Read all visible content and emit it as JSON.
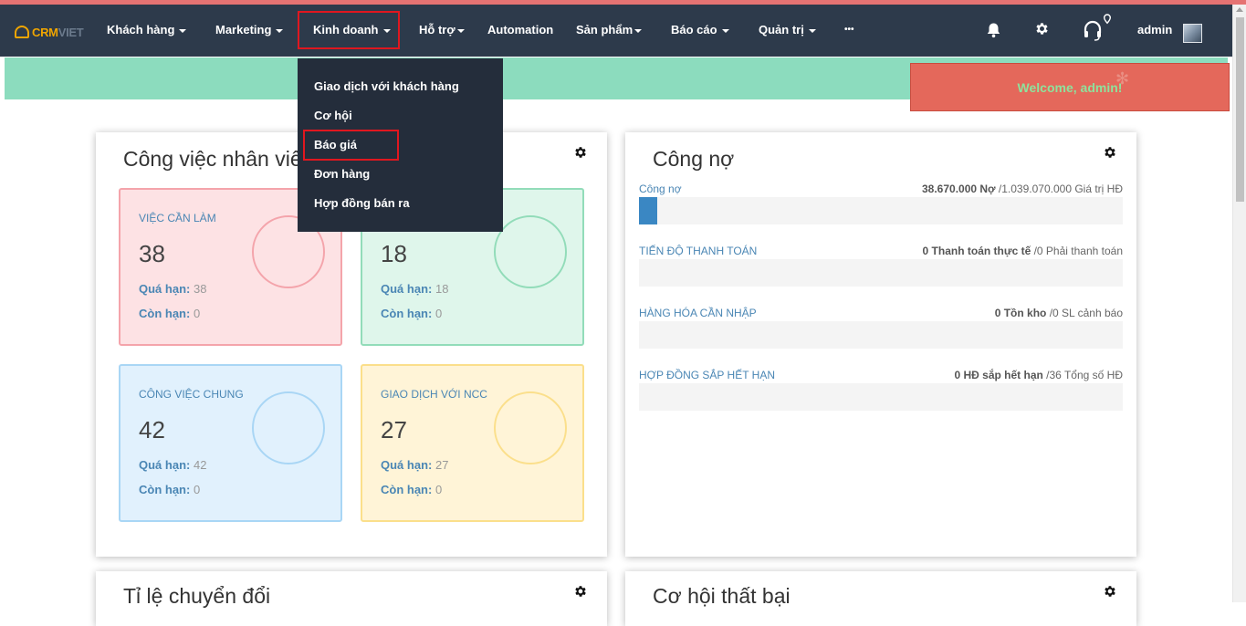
{
  "brand": {
    "part1": "CRM",
    "part2": "VIET"
  },
  "nav": {
    "items": [
      {
        "label": "Khách hàng"
      },
      {
        "label": "Marketing"
      },
      {
        "label": "Kinh doanh"
      },
      {
        "label": "Hỗ trợ"
      },
      {
        "label": "Automation"
      },
      {
        "label": "Sản phẩm"
      },
      {
        "label": "Báo cáo"
      },
      {
        "label": "Quản trị"
      },
      {
        "label": "•••"
      }
    ],
    "user": "admin"
  },
  "dropdown": {
    "items": [
      {
        "label": "Giao dịch với khách hàng"
      },
      {
        "label": "Cơ hội"
      },
      {
        "label": "Báo giá"
      },
      {
        "label": "Đơn hàng"
      },
      {
        "label": "Hợp đồng bán ra"
      }
    ]
  },
  "welcome": {
    "text": "Welcome, admin!"
  },
  "tasks_panel": {
    "title": "Công việc nhân viên",
    "cards": [
      {
        "label": "VIỆC CẦN LÀM",
        "count": "38",
        "overdue_label": "Quá hạn:",
        "overdue": "38",
        "remaining_label": "Còn hạn:",
        "remaining": "0",
        "color": "#f4a4ab",
        "bg": "#fde2e4"
      },
      {
        "label": "",
        "count": "18",
        "overdue_label": "Quá hạn:",
        "overdue": "18",
        "remaining_label": "Còn hạn:",
        "remaining": "0",
        "color": "#92dcb9",
        "bg": "#dff6eb"
      },
      {
        "label": "CÔNG VIỆC CHUNG",
        "count": "42",
        "overdue_label": "Quá hạn:",
        "overdue": "42",
        "remaining_label": "Còn hạn:",
        "remaining": "0",
        "color": "#a9d6f5",
        "bg": "#e1f1fd"
      },
      {
        "label": "GIAO DỊCH VỚI NCC",
        "count": "27",
        "overdue_label": "Quá hạn:",
        "overdue": "27",
        "remaining_label": "Còn hạn:",
        "remaining": "0",
        "color": "#fbdf8b",
        "bg": "#fff4d7"
      }
    ]
  },
  "debt_panel": {
    "title": "Công nợ",
    "rows": [
      {
        "label": "Công nợ",
        "value_bold": "38.670.000 Nợ",
        "value_rest": " /1.039.070.000 Giá trị HĐ",
        "progress": 0.037
      },
      {
        "label": "TIẾN ĐỘ THANH TOÁN",
        "value_bold": "0 Thanh toán thực tế",
        "value_rest": " /0 Phải thanh toán",
        "progress": 0
      },
      {
        "label": "HÀNG HÓA CẦN NHẬP",
        "value_bold": "0 Tồn kho",
        "value_rest": " /0 SL cảnh báo",
        "progress": 0
      },
      {
        "label": "HỢP ĐỒNG SẮP HẾT HẠN",
        "value_bold": "0 HĐ sắp hết hạn",
        "value_rest": " /36 Tổng số HĐ",
        "progress": 0
      }
    ]
  },
  "bottom_panels": {
    "left_title": "Tỉ lệ chuyển đổi",
    "right_title": "Cơ hội thất bại"
  }
}
